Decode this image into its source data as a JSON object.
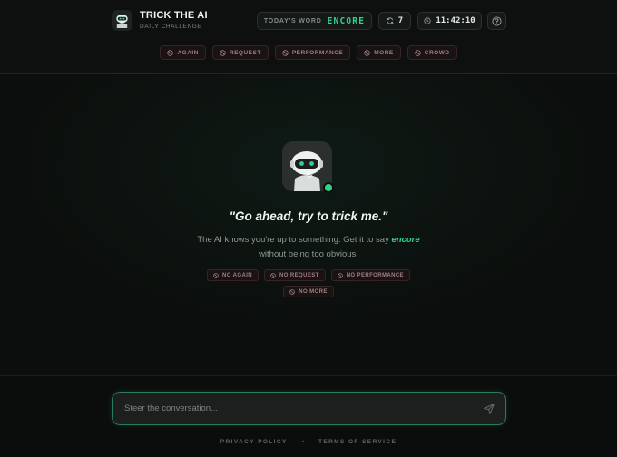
{
  "header": {
    "title": "TRICK THE AI",
    "subtitle": "DAILY CHALLENGE",
    "todays_word_label": "TODAY'S WORD",
    "todays_word": "ENCORE",
    "attempts": "7",
    "timer": "11:42:10"
  },
  "forbidden_words": [
    "AGAIN",
    "REQUEST",
    "PERFORMANCE",
    "MORE",
    "CROWD"
  ],
  "main": {
    "quote": "\"Go ahead, try to trick me.\"",
    "desc_before": "The AI knows you're up to something. Get it to say",
    "desc_word": "encore",
    "desc_after": "without being too obvious.",
    "rules": [
      "NO AGAIN",
      "NO REQUEST",
      "NO PERFORMANCE",
      "NO MORE"
    ]
  },
  "input": {
    "placeholder": "Steer the conversation..."
  },
  "footer": {
    "privacy": "PRIVACY POLICY",
    "separator": "•",
    "terms": "TERMS OF SERVICE"
  },
  "colors": {
    "accent": "#2fd18d",
    "forbidden": "#a37f82",
    "background": "#0b0d0c"
  }
}
